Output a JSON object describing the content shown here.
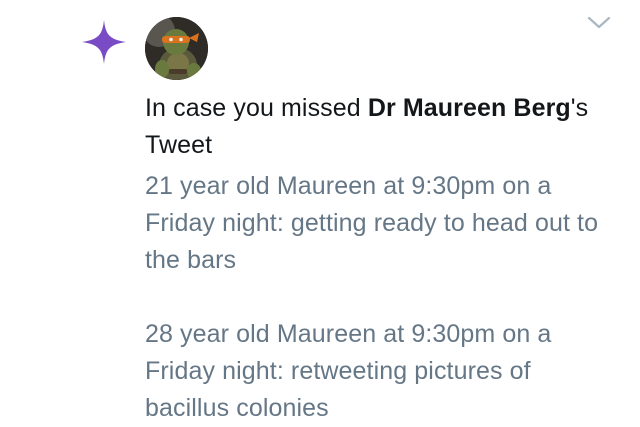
{
  "notification": {
    "headline_prefix": "In case you missed ",
    "author_name": "Dr Maureen Berg",
    "headline_suffix": "'s Tweet",
    "tweet_text": "21 year old Maureen at 9:30pm on a Friday night: getting ready to head out to the bars\n\n28 year old Maureen at 9:30pm on a Friday night: retweeting pictures of bacillus colonies"
  },
  "icons": {
    "sparkle": "sparkle-icon",
    "chevron": "chevron-down-icon",
    "avatar": "avatar"
  },
  "colors": {
    "sparkle": "#794bc4",
    "headline_text": "#14171a",
    "tweet_text": "#657786",
    "chevron": "#aab8c2"
  }
}
